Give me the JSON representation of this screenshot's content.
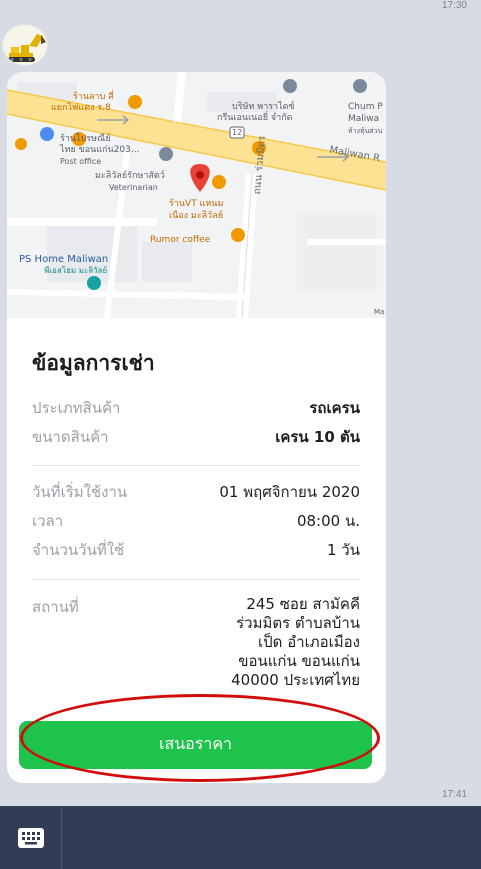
{
  "timestamps": {
    "top": "17:30",
    "bottom": "17:41"
  },
  "map": {
    "labels": [
      {
        "text": "ร้านลาบ สี่",
        "cls": "orange"
      },
      {
        "text": "แยกไฟแดง ร.8",
        "cls": "orange"
      },
      {
        "text": "บริษัท พาราไดซ์",
        "cls": "grey"
      },
      {
        "text": "กรีนเอนเนอยี่ จำกัด",
        "cls": "grey"
      },
      {
        "text": "Chum P",
        "cls": "grey"
      },
      {
        "text": "Maliwa",
        "cls": "grey"
      },
      {
        "text": "ห้างหุ้นส่วน",
        "cls": "grey"
      },
      {
        "text": "ร้านไปรษณีย์",
        "cls": "grey"
      },
      {
        "text": "ไทย ขอนแก่น203...",
        "cls": "grey"
      },
      {
        "text": "Post office",
        "cls": "grey"
      },
      {
        "text": "Maliwan R",
        "cls": "road"
      },
      {
        "text": "มะลิวัลย์รักษาสัตว์",
        "cls": "grey"
      },
      {
        "text": "Veterinarian",
        "cls": "grey"
      },
      {
        "text": "ร้านVT แหนม",
        "cls": "orange"
      },
      {
        "text": "เนือง มะลิวัลย์",
        "cls": "orange"
      },
      {
        "text": "Rumor coffee",
        "cls": "orange"
      },
      {
        "text": "PS Home Maliwan",
        "cls": "blue"
      },
      {
        "text": "พีเอสโฮม มะลิวัลย์",
        "cls": "teal"
      },
      {
        "text": "ถนน ร่วมมิตร",
        "cls": "road"
      },
      {
        "text": "12",
        "cls": "grey"
      },
      {
        "text": "Ma",
        "cls": "grey"
      }
    ]
  },
  "rental": {
    "title": "ข้อมูลการเช่า",
    "product_type_label": "ประเภทสินค้า",
    "product_type_value": "รถเครน",
    "product_size_label": "ขนาดสินค้า",
    "product_size_value": "เครน 10 ตัน",
    "start_date_label": "วันที่เริ่มใช้งาน",
    "start_date_value": "01 พฤศจิกายน 2020",
    "time_label": "เวลา",
    "time_value": "08:00 น.",
    "days_label": "จำนวนวันที่ใช้",
    "days_value": "1 วัน",
    "location_label": "สถานที่",
    "location_lines": [
      "245 ซอย สามัคคี",
      "ร่วมมิตร ตำบลบ้าน",
      "เป็ด อำเภอเมือง",
      "ขอนแก่น ขอนแก่น",
      "40000 ประเทศไทย"
    ],
    "offer_button": "เสนอราคา"
  },
  "colors": {
    "button": "#1ec34c",
    "highlight_circle": "#d10c0c",
    "bottom_bar": "#323d55"
  }
}
